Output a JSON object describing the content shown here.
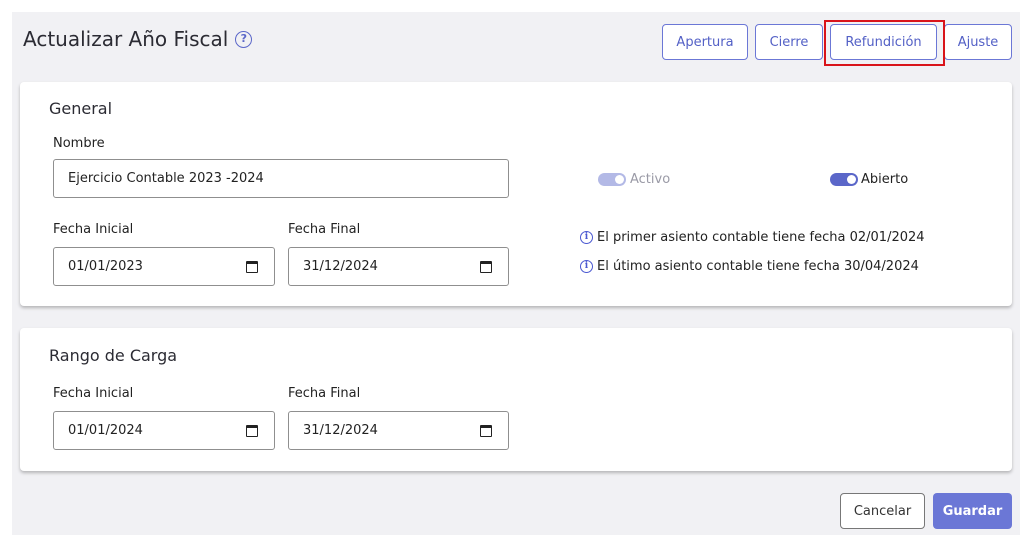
{
  "header": {
    "title": "Actualizar Año Fiscal",
    "help_icon": "?",
    "buttons": [
      "Apertura",
      "Cierre",
      "Refundición",
      "Ajuste"
    ]
  },
  "general": {
    "section_title": "General",
    "nombre_label": "Nombre",
    "nombre_value": "Ejercicio Contable 2023 -2024",
    "activo_label": "Activo",
    "abierto_label": "Abierto",
    "fecha_inicial_label": "Fecha Inicial",
    "fecha_inicial_value": "01/01/2023",
    "fecha_final_label": "Fecha Final",
    "fecha_final_value": "31/12/2024",
    "info_first": "El primer asiento contable tiene fecha 02/01/2024",
    "info_last": "El útimo asiento contable tiene fecha 30/04/2024",
    "info_icon": "i"
  },
  "rango": {
    "section_title": "Rango de Carga",
    "fecha_inicial_label": "Fecha Inicial",
    "fecha_inicial_value": "01/01/2024",
    "fecha_final_label": "Fecha Final",
    "fecha_final_value": "31/12/2024"
  },
  "footer": {
    "cancel_label": "Cancelar",
    "save_label": "Guardar"
  },
  "colors": {
    "accent": "#6b77d6",
    "accent_dark": "#5360c6",
    "toggle_on": "#5b67c9",
    "toggle_disabled": "#b3b9e6",
    "highlight": "#d9141a"
  }
}
